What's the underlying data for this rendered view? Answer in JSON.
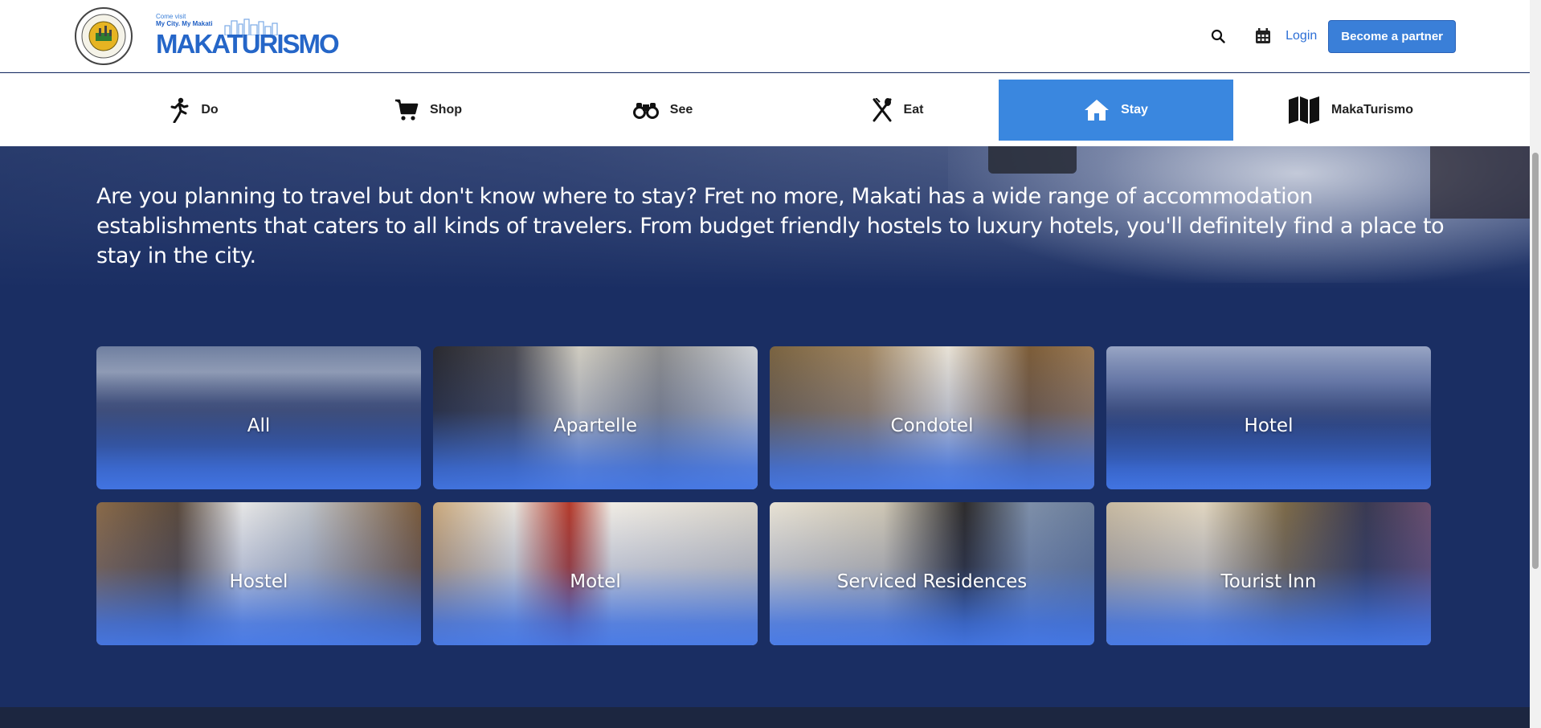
{
  "header": {
    "seal_text": "LUNGSOD NG MAKATI · PILIPINAS · 1670",
    "brand_tagline_1": "Come visit",
    "brand_tagline_2": "My City. My Makati",
    "brand_wordmark": "MAKATURISMO",
    "login_label": "Login",
    "partner_label": "Become a partner",
    "icons": [
      "search-icon",
      "calendar-icon"
    ]
  },
  "nav": {
    "items": [
      {
        "label": "Do",
        "icon": "running-person-icon",
        "active": false
      },
      {
        "label": "Shop",
        "icon": "cart-icon",
        "active": false
      },
      {
        "label": "See",
        "icon": "binoculars-icon",
        "active": false
      },
      {
        "label": "Eat",
        "icon": "utensils-icon",
        "active": false
      },
      {
        "label": "Stay",
        "icon": "home-icon",
        "active": true
      },
      {
        "label": "MakaTurismo",
        "icon": "map-icon",
        "active": false
      }
    ]
  },
  "hero": {
    "text": "Are you planning to travel but don't know where to stay? Fret no more, Makati has a wide range of accommodation establishments that caters to all kinds of travelers. From budget friendly hostels to luxury hotels, you'll definitely find a place to stay in the city."
  },
  "categories": [
    {
      "label": "All"
    },
    {
      "label": "Apartelle"
    },
    {
      "label": "Condotel"
    },
    {
      "label": "Hotel"
    },
    {
      "label": "Hostel"
    },
    {
      "label": "Motel"
    },
    {
      "label": "Serviced Residences"
    },
    {
      "label": "Tourist Inn"
    }
  ],
  "colors": {
    "primary": "#3a87df",
    "page_background": "#1a2e63",
    "link": "#2d6fd6"
  }
}
